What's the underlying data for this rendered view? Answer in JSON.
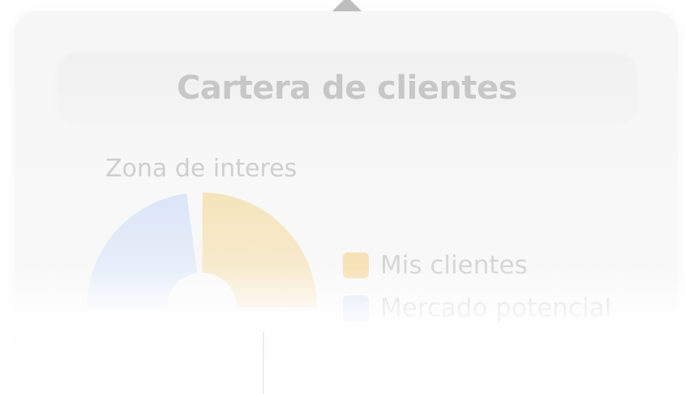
{
  "header": {
    "title": "Cartera de clientes"
  },
  "section": {
    "title": "Zona de interes"
  },
  "legend": [
    {
      "label": "Mis clientes",
      "color": "#f6e2b8"
    },
    {
      "label": "Mercado potencial",
      "color": "#dde7f7"
    }
  ],
  "chart_data": {
    "type": "pie",
    "style": "partial-donut",
    "series": [
      {
        "name": "Mis clientes",
        "value": 0.52,
        "color": "#f7e6bd"
      },
      {
        "name": "Mercado potencial",
        "value": 0.48,
        "color": "#dde7f8"
      }
    ]
  },
  "icons": {
    "top_indicator": "diamond-icon"
  },
  "colors": {
    "card_bg": "#f7f7f7",
    "title_text": "#c7c7c7",
    "legend_text": "#d6d6d6"
  }
}
